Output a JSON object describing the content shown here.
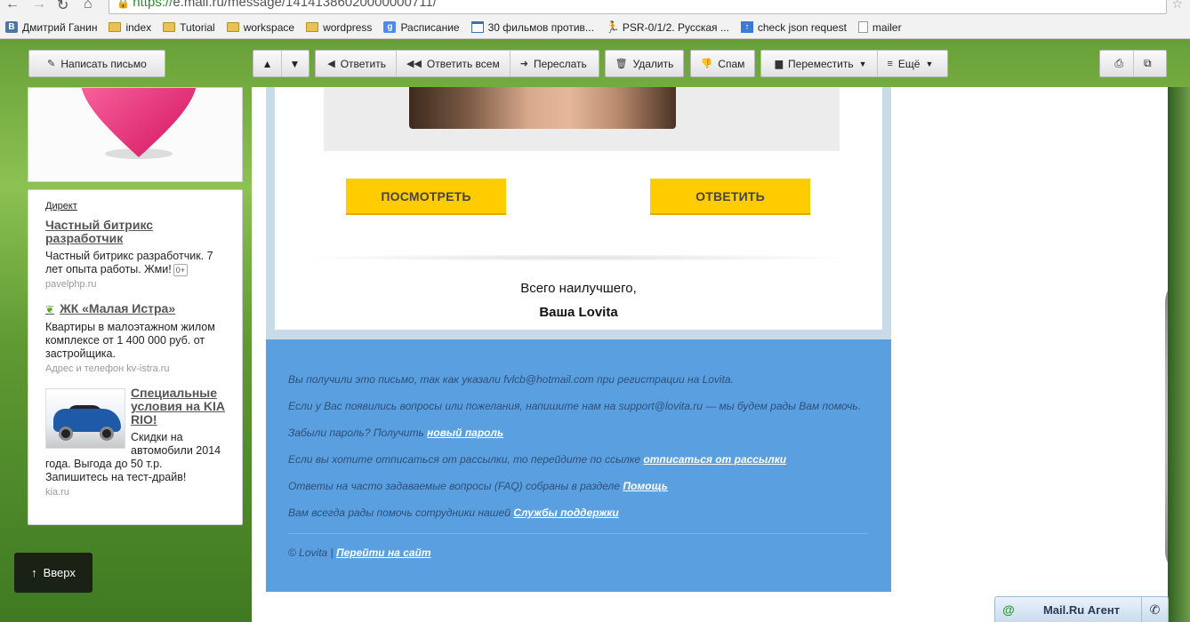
{
  "browser": {
    "url_scheme": "https://",
    "url_rest": "e.mail.ru/message/14141386020000000711/",
    "bookmarks": [
      {
        "label": "Дмитрий Ганин",
        "icon": "vk-icon"
      },
      {
        "label": "index",
        "icon": "folder-icon"
      },
      {
        "label": "Tutorial",
        "icon": "folder-icon"
      },
      {
        "label": "workspace",
        "icon": "folder-icon"
      },
      {
        "label": "wordpress",
        "icon": "folder-icon"
      },
      {
        "label": "Расписание",
        "icon": "google-icon"
      },
      {
        "label": "30 фильмов против...",
        "icon": "calendar-icon"
      },
      {
        "label": "PSR-0/1/2. Русская ...",
        "icon": "runner-icon"
      },
      {
        "label": "check json request",
        "icon": "arrow-up-icon"
      },
      {
        "label": "mailer",
        "icon": "page-icon"
      }
    ]
  },
  "toolbar": {
    "compose": "Написать письмо",
    "reply": "Ответить",
    "reply_all": "Ответить всем",
    "forward": "Переслать",
    "delete": "Удалить",
    "spam": "Спам",
    "move": "Переместить",
    "more": "Ещё"
  },
  "ads": {
    "header": "Директ",
    "items": [
      {
        "title": "Частный битрикс разработчик",
        "desc": "Частный битрикс разработчик. 7 лет опыта работы. Жми!",
        "badge": "0+",
        "url": "pavelphp.ru"
      },
      {
        "title": "ЖК «Малая Истра»",
        "desc": "Квартиры в малоэтажном жилом комплексе от 1 400 000 руб. от застройщика.",
        "url": "Адрес и телефон  kv-istra.ru"
      },
      {
        "title": "Специальные условия на KIA RIO!",
        "desc": "Скидки на автомобили 2014 года. Выгода до 50 т.р. Запишитесь на тест-драйв!",
        "url": "kia.ru"
      }
    ]
  },
  "scroll_up": "Вверх",
  "message": {
    "btn_view": "ПОСМОТРЕТЬ",
    "btn_reply": "ОТВЕТИТЬ",
    "sign_line1": "Всего наилучшего,",
    "sign_line2": "Ваша Lovita",
    "footer": {
      "line1": "Вы получили это письмо, так как указали fvlcb@hotmail.com при регистрации на Lovita.",
      "line2": "Если у Вас появились вопросы или пожелания, напишите нам на support@lovita.ru — мы будем рады Вам помочь.",
      "line3_text": "Забыли пароль? Получить ",
      "line3_link": "новый пароль",
      "line4_text": "Если вы хотите отписаться от рассылки, то перейдите по ссылке ",
      "line4_link": "отписаться от рассылки",
      "line5_text": "Ответы на часто задаваемые вопросы (FAQ) собраны в разделе ",
      "line5_link": "Помощь",
      "line6_text": "Вам всегда рады помочь сотрудники нашей ",
      "line6_link": "Службы поддержки",
      "copy_text": "© Lovita | ",
      "copy_link": "Перейти на сайт"
    }
  },
  "agent": {
    "label": "Mail.Ru Агент"
  },
  "colors": {
    "cta": "#ffcc00",
    "footer_bg": "#5aa0e0",
    "frame": "#c8dbe8"
  }
}
